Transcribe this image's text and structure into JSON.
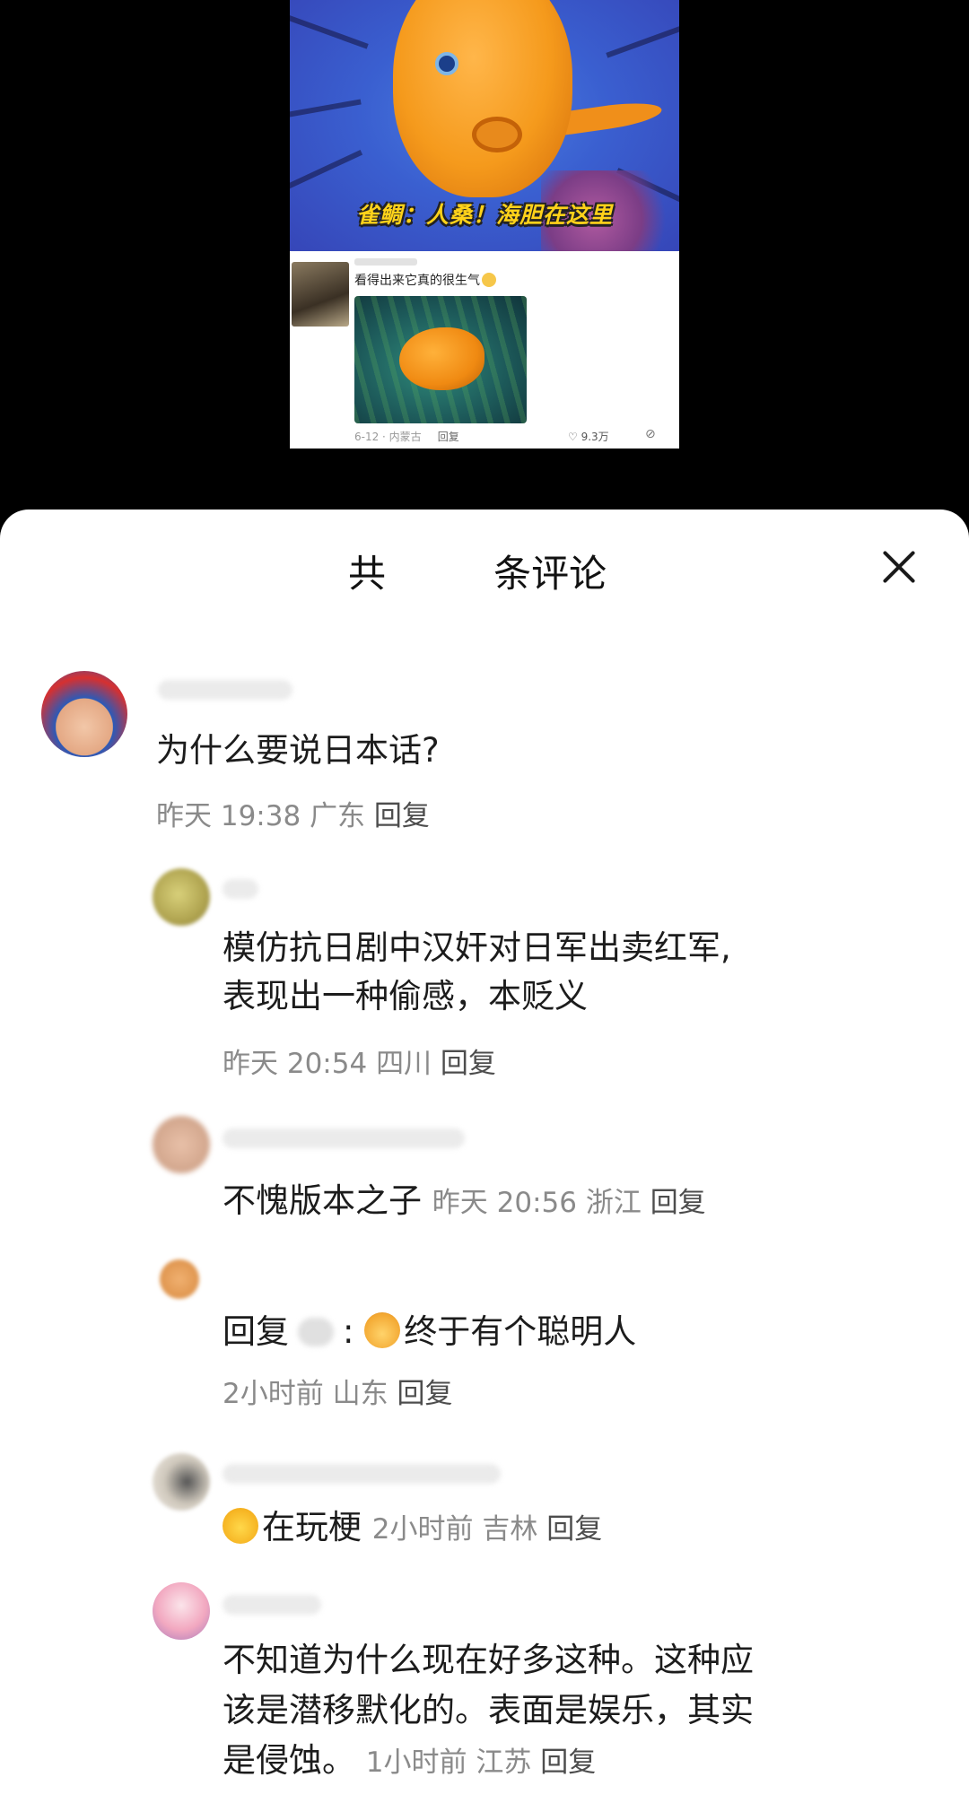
{
  "media": {
    "caption": "雀鲷：人桑！海胆在这里",
    "inner_comment": {
      "text": "看得出来它真的很生气",
      "date_location": "6-12 · 内蒙古",
      "reply": "回复",
      "likes": "9.3万"
    }
  },
  "sheet": {
    "title": "共         条评论",
    "close_icon": "close-icon"
  },
  "comments": [
    {
      "text": "为什么要说日本话?",
      "time": "昨天 19:38",
      "location": "广东",
      "reply": "回复"
    },
    {
      "text_line1": "模仿抗日剧中汉奸对日军出卖红军,",
      "text_line2": "表现出一种偷感，本贬义",
      "time": "昨天 20:54",
      "location": "四川",
      "reply": "回复"
    },
    {
      "text": "不愧版本之子",
      "time": "昨天 20:56",
      "location": "浙江",
      "reply": "回复"
    },
    {
      "prefix": "回复",
      "colon": ":",
      "text": "终于有个聪明人",
      "time": "2小时前",
      "location": "山东",
      "reply": "回复"
    },
    {
      "text": "在玩梗",
      "time": "2小时前",
      "location": "吉林",
      "reply": "回复"
    },
    {
      "text_line1": "不知道为什么现在好多这种。这种应",
      "text_line2": "该是潜移默化的。表面是娱乐，其实",
      "text_line3": "是侵蚀。",
      "time": "1小时前",
      "location": "江苏",
      "reply": "回复"
    }
  ]
}
